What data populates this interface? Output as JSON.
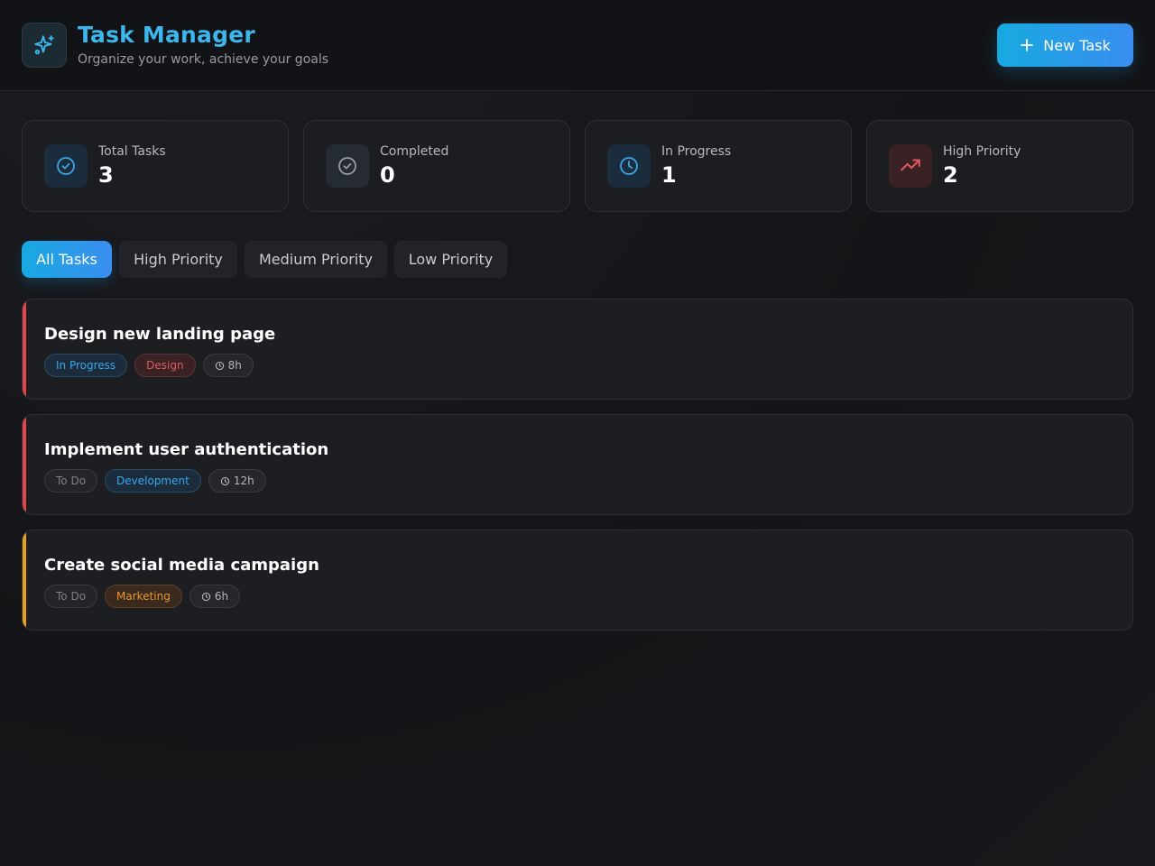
{
  "header": {
    "title": "Task Manager",
    "subtitle": "Organize your work, achieve your goals",
    "new_task_label": "New Task",
    "logo_icon": "sparkles-icon",
    "accent": "#3cb6ec"
  },
  "stats": [
    {
      "label": "Total Tasks",
      "value": "3",
      "icon": "check-circle-icon",
      "color": "#3aa6e8"
    },
    {
      "label": "Completed",
      "value": "0",
      "icon": "check-circle-icon",
      "color": "#9a9ca3"
    },
    {
      "label": "In Progress",
      "value": "1",
      "icon": "clock-icon",
      "color": "#3aa6e8"
    },
    {
      "label": "High Priority",
      "value": "2",
      "icon": "trending-up-icon",
      "color": "#e05a5f"
    }
  ],
  "filters": [
    {
      "label": "All Tasks",
      "active": true
    },
    {
      "label": "High Priority",
      "active": false
    },
    {
      "label": "Medium Priority",
      "active": false
    },
    {
      "label": "Low Priority",
      "active": false
    }
  ],
  "tasks": [
    {
      "title": "Design new landing page",
      "status": "In Progress",
      "category": "Design",
      "estimate": "8h",
      "priority_color": "#e0454c"
    },
    {
      "title": "Implement user authentication",
      "status": "To Do",
      "category": "Development",
      "estimate": "12h",
      "priority_color": "#e0454c"
    },
    {
      "title": "Create social media campaign",
      "status": "To Do",
      "category": "Marketing",
      "estimate": "6h",
      "priority_color": "#e6a020"
    }
  ]
}
